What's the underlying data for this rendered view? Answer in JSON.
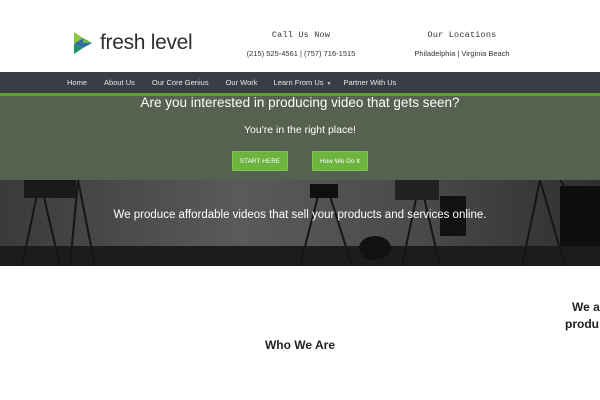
{
  "header": {
    "logo_text": "fresh level",
    "call": {
      "title": "Call Us Now",
      "phones": "(215) 525-4561 | (757) 716-1515"
    },
    "locations": {
      "title": "Our Locations",
      "cities": "Philadelphia | Virginia Beach"
    }
  },
  "nav": {
    "items": [
      {
        "label": "Home"
      },
      {
        "label": "About Us"
      },
      {
        "label": "Our Core Genius"
      },
      {
        "label": "Our Work"
      },
      {
        "label": "Learn From Us",
        "caret": "▼"
      },
      {
        "label": "Partner With Us"
      }
    ]
  },
  "hero": {
    "heading": "Are you interested in producing video that gets seen?",
    "subheading": "You're in the right place!",
    "start_button": "START HERE",
    "how_button": "How We Do It",
    "tagline": "We produce affordable videos that sell your products and services online."
  },
  "below": {
    "cutoff_line1": "We a",
    "cutoff_line2": "produ",
    "who_title": "Who We Are"
  },
  "colors": {
    "nav_bg": "#3b3d46",
    "accent_green": "#6cb33f",
    "overlay_green": "#56624f"
  }
}
